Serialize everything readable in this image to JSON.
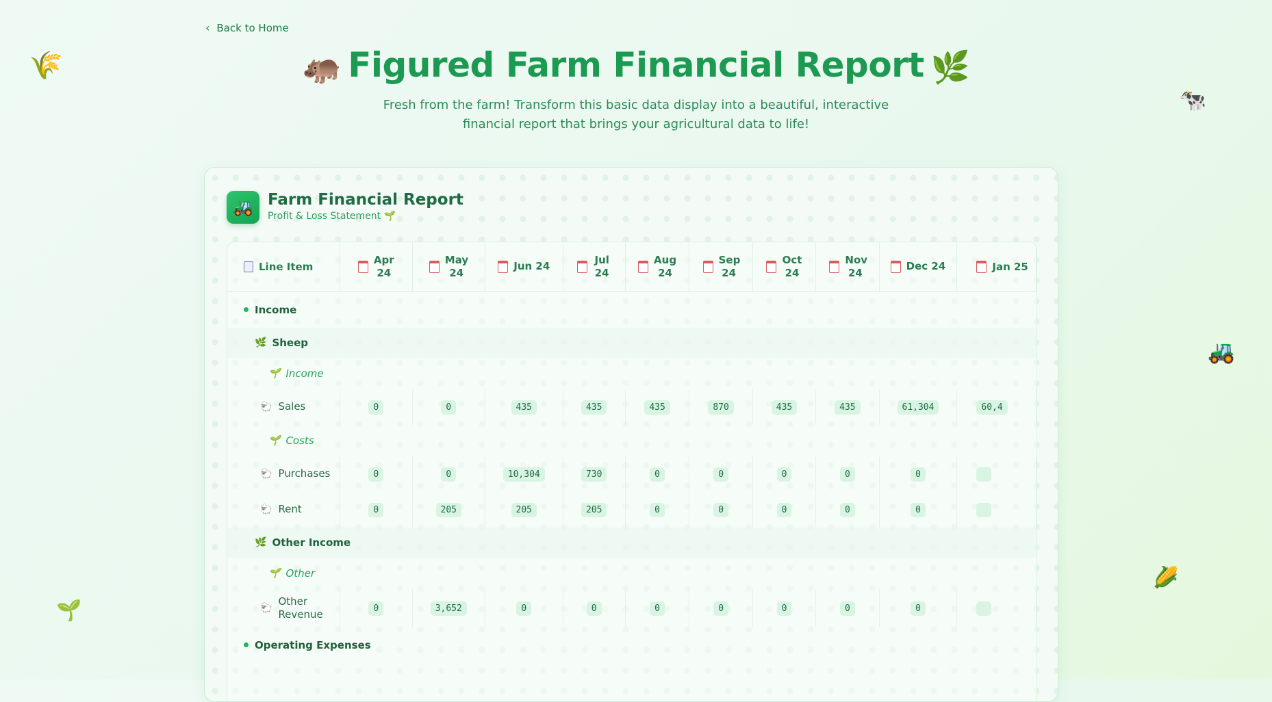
{
  "nav": {
    "back_label": "Back to Home"
  },
  "hero": {
    "title": "Figured Farm Financial Report",
    "subtitle_line1": "Fresh from the farm! Transform this basic data display into a beautiful, interactive",
    "subtitle_line2": "financial report that brings your agricultural data to life!"
  },
  "report": {
    "title": "Farm Financial Report",
    "subtitle": "Profit & Loss Statement"
  },
  "table": {
    "first_header": "Line Item",
    "months": [
      "Apr 24",
      "May 24",
      "Jun 24",
      "Jul 24",
      "Aug 24",
      "Sep 24",
      "Oct 24",
      "Nov 24",
      "Dec 24",
      "Jan 25"
    ],
    "rows": [
      {
        "type": "section",
        "label": "Income"
      },
      {
        "type": "category",
        "label": "Sheep"
      },
      {
        "type": "subcategory",
        "label": "Income"
      },
      {
        "type": "item",
        "label": "Sales",
        "values": [
          "0",
          "0",
          "435",
          "435",
          "435",
          "870",
          "435",
          "435",
          "61,304",
          "60,4"
        ]
      },
      {
        "type": "subcategory",
        "label": "Costs"
      },
      {
        "type": "item",
        "label": "Purchases",
        "values": [
          "0",
          "0",
          "10,304",
          "730",
          "0",
          "0",
          "0",
          "0",
          "0",
          ""
        ]
      },
      {
        "type": "item",
        "label": "Rent",
        "values": [
          "0",
          "205",
          "205",
          "205",
          "0",
          "0",
          "0",
          "0",
          "0",
          ""
        ]
      },
      {
        "type": "category",
        "label": "Other Income"
      },
      {
        "type": "subcategory",
        "label": "Other"
      },
      {
        "type": "item",
        "label": "Other Revenue",
        "values": [
          "0",
          "3,652",
          "0",
          "0",
          "0",
          "0",
          "0",
          "0",
          "0",
          ""
        ]
      },
      {
        "type": "section",
        "label": "Operating Expenses"
      }
    ]
  }
}
